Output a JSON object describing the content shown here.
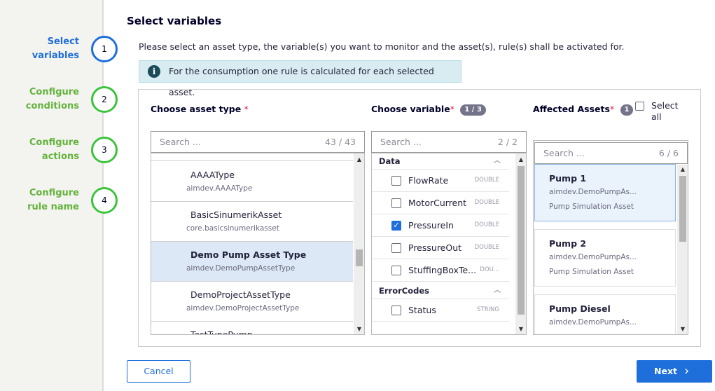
{
  "steps": [
    {
      "number": "1",
      "label_line1": "Select",
      "label_line2": "variables",
      "active": true
    },
    {
      "number": "2",
      "label_line1": "Configure",
      "label_line2": "conditions",
      "active": false
    },
    {
      "number": "3",
      "label_line1": "Configure",
      "label_line2": "actions",
      "active": false
    },
    {
      "number": "4",
      "label_line1": "Configure",
      "label_line2": "rule name",
      "active": false
    }
  ],
  "title": "Select variables",
  "intro": "Please select an asset type, the variable(s) you want to monitor and the asset(s), rule(s) shall be activated for.",
  "info": {
    "icon": "info-icon",
    "text": "For the consumption one rule is calculated for each selected asset."
  },
  "asset_type": {
    "title": "Choose asset type",
    "required_mark": "*",
    "search_placeholder": "Search ...",
    "search_count": "43 / 43",
    "items": [
      {
        "name": "AAAAType",
        "sub": "aimdev.AAAAType",
        "selected": false
      },
      {
        "name": "BasicSinumerikAsset",
        "sub": "core.basicsinumerikasset",
        "selected": false
      },
      {
        "name": "Demo Pump Asset Type",
        "sub": "aimdev.DemoPumpAssetType",
        "selected": true
      },
      {
        "name": "DemoProjectAssetType",
        "sub": "aimdev.DemoProjectAssetType",
        "selected": false
      },
      {
        "name": "TestTypePump",
        "sub": "",
        "selected": false
      }
    ]
  },
  "variable": {
    "title": "Choose variable",
    "required_mark": "*",
    "badge": "1 / 3",
    "search_placeholder": "Search ...",
    "search_count": "2 / 2",
    "groups": [
      {
        "name": "Data",
        "rows": [
          {
            "name": "FlowRate",
            "type": "DOUBLE",
            "checked": false
          },
          {
            "name": "MotorCurrent",
            "type": "DOUBLE",
            "checked": false
          },
          {
            "name": "PressureIn",
            "type": "DOUBLE",
            "checked": true
          },
          {
            "name": "PressureOut",
            "type": "DOUBLE",
            "checked": false
          },
          {
            "name": "StuffingBoxTe...",
            "type": "DOU...",
            "checked": false
          }
        ]
      },
      {
        "name": "ErrorCodes",
        "rows": [
          {
            "name": "Status",
            "type": "STRING",
            "checked": false
          }
        ]
      }
    ]
  },
  "assets": {
    "title": "Affected Assets",
    "required_mark": "*",
    "badge": "1",
    "select_all": "Select all",
    "search_placeholder": "Search ...",
    "search_count": "6 / 6",
    "items": [
      {
        "name": "Pump 1",
        "sub": "aimdev.DemoPumpAs...",
        "type": "Pump Simulation Asset",
        "selected": true
      },
      {
        "name": "Pump 2",
        "sub": "aimdev.DemoPumpAs...",
        "type": "Pump Simulation Asset",
        "selected": false
      },
      {
        "name": "Pump Diesel",
        "sub": "aimdev.DemoPumpAs...",
        "type": "",
        "selected": false
      }
    ]
  },
  "buttons": {
    "cancel": "Cancel",
    "next": "Next"
  },
  "colors": {
    "accent": "#1e6edc",
    "step_done": "#64b43c",
    "selected_bg": "#dce8f5"
  }
}
